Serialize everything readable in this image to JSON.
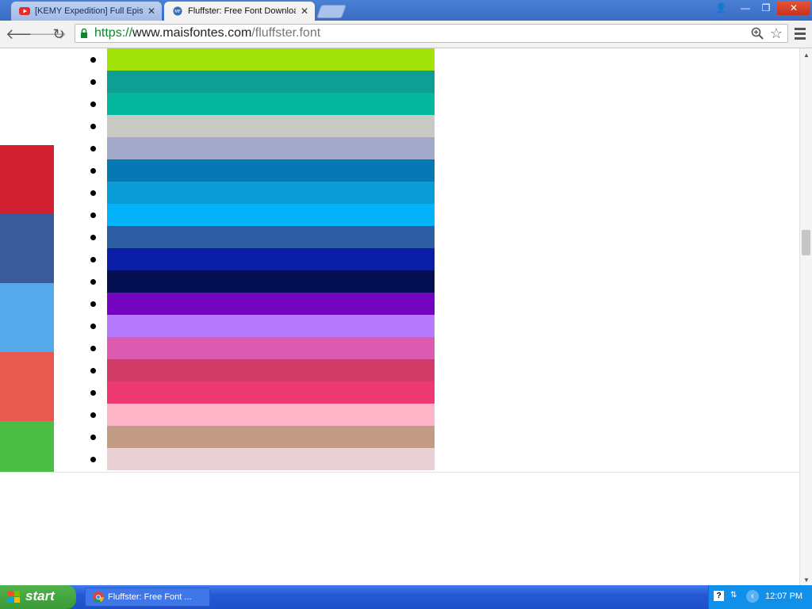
{
  "browser": {
    "tabs": [
      {
        "label": "[KEMY Expedition] Full Episod",
        "favicon": "youtube-icon",
        "active": false
      },
      {
        "label": "Fluffster: Free Font Downloa",
        "favicon": "maisfontes-icon",
        "active": true
      }
    ],
    "window_controls": {
      "user": "👤",
      "minimize": "—",
      "restore": "❐",
      "close": "✕"
    },
    "url": {
      "scheme": "https://",
      "host": "www.maisfontes.com",
      "path": "/fluffster.font"
    }
  },
  "page": {
    "sidebar_colors": [
      "#d22030",
      "#3a5a99",
      "#55aaeb",
      "#e85a4f",
      "#4bbf45"
    ],
    "palette_colors": [
      "#8dbd1e",
      "#a2e40a",
      "#0f9e94",
      "#03b89c",
      "#c8cac3",
      "#a3a9c9",
      "#0679b5",
      "#0a9cd7",
      "#02b3fa",
      "#2c5da3",
      "#0b1ea6",
      "#040f52",
      "#7404bf",
      "#b57aff",
      "#dc5bb0",
      "#d23a67",
      "#ee3871",
      "#ffb5c8",
      "#c29b85",
      "#e8d0d4"
    ]
  },
  "taskbar": {
    "start_label": "start",
    "task_label": "Fluffster: Free Font ...",
    "tray_help": "?",
    "tray_toggle": "‹",
    "clock": "12:07 PM"
  }
}
